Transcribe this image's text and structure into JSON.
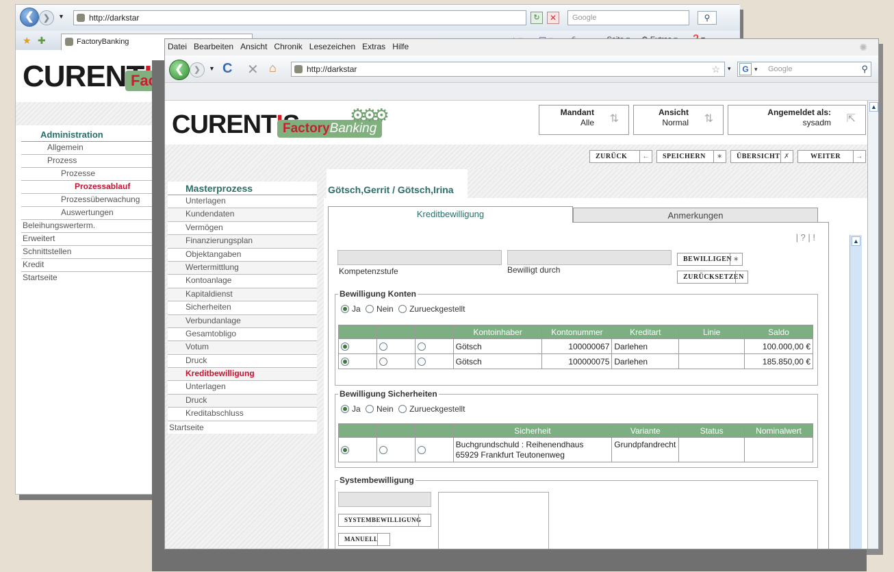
{
  "back_window": {
    "url": "http://darkstar",
    "search_placeholder": "Google",
    "tab_title": "FactoryBanking",
    "toolbar": {
      "seite": "Seite",
      "extras": "Extras"
    },
    "logo": {
      "main": "CURENT",
      "i": "I",
      "s": "S",
      "badge": "Facto"
    },
    "menu": {
      "title": "Administration",
      "items": [
        {
          "label": "Allgemein",
          "level": 1,
          "active": false
        },
        {
          "label": "Prozess",
          "level": 1,
          "active": false
        },
        {
          "label": "Prozesse",
          "level": 2,
          "active": false
        },
        {
          "label": "Prozessablauf",
          "level": 3,
          "active": true
        },
        {
          "label": "Prozessüberwachung",
          "level": 2,
          "active": false
        },
        {
          "label": "Auswertungen",
          "level": 2,
          "active": false
        },
        {
          "label": "Beleihungswerterm.",
          "level": 0,
          "active": false
        },
        {
          "label": "Erweitert",
          "level": 0,
          "active": false
        },
        {
          "label": "Schnittstellen",
          "level": 0,
          "active": false
        },
        {
          "label": "Kredit",
          "level": 0,
          "active": false
        }
      ],
      "footer": "Startseite"
    }
  },
  "front_window": {
    "menubar": [
      "Datei",
      "Bearbeiten",
      "Ansicht",
      "Chronik",
      "Lesezeichen",
      "Extras",
      "Hilfe"
    ],
    "url": "http://darkstar",
    "search_placeholder": "Google",
    "logo": {
      "main": "CURENT",
      "i": "I",
      "s": "S",
      "badge_a": "Factory",
      "badge_b": "Banking"
    },
    "header": {
      "mandant_label": "Mandant",
      "mandant_value": "Alle",
      "ansicht_label": "Ansicht",
      "ansicht_value": "Normal",
      "user_label": "Angemeldet als:",
      "user_value": "sysadm"
    },
    "toolbar": {
      "back": "ZURÜCK",
      "back_sym": "←",
      "save": "SPEICHERN",
      "save_sym": "∗",
      "overview": "ÜBERSICHT",
      "overview_sym": "✗",
      "next": "WEITER",
      "next_sym": "→"
    },
    "sidebar": {
      "title": "Masterprozess",
      "items": [
        {
          "label": "Unterlagen",
          "active": false
        },
        {
          "label": "Kundendaten",
          "active": false
        },
        {
          "label": "Vermögen",
          "active": false
        },
        {
          "label": "Finanzierungsplan",
          "active": false
        },
        {
          "label": "Objektangaben",
          "active": false
        },
        {
          "label": "Wertermittlung",
          "active": false
        },
        {
          "label": "Kontoanlage",
          "active": false
        },
        {
          "label": "Kapitaldienst",
          "active": false
        },
        {
          "label": "Sicherheiten",
          "active": false
        },
        {
          "label": "Verbundanlage",
          "active": false
        },
        {
          "label": "Gesamtobligo",
          "active": false
        },
        {
          "label": "Votum",
          "active": false
        },
        {
          "label": "Druck",
          "active": false
        },
        {
          "label": "Kreditbewilligung",
          "active": true
        },
        {
          "label": "Unterlagen",
          "active": false
        },
        {
          "label": "Druck",
          "active": false
        },
        {
          "label": "Kreditabschluss",
          "active": false
        }
      ],
      "footer": "Startseite"
    },
    "customer": "Götsch,Gerrit / Götsch,Irina",
    "tabs": {
      "active": "Kreditbewilligung",
      "other": "Anmerkungen"
    },
    "help_links": "| ? | !",
    "approval": {
      "kompetenz_label": "Kompetenzstufe",
      "bewilligt_label": "Bewilligt durch",
      "approve_btn": "BEWILLIGEN",
      "approve_sym": "∗",
      "reset_btn": "ZURÜCKSETZEN"
    },
    "konten": {
      "legend": "Bewilligung Konten",
      "options": [
        "Ja",
        "Nein",
        "Zurueckgestellt"
      ],
      "columns": [
        "Kontoinhaber",
        "Kontonummer",
        "Kreditart",
        "Linie",
        "Saldo"
      ],
      "rows": [
        {
          "owner": "Götsch",
          "number": "100000067",
          "type": "Darlehen",
          "line": "",
          "saldo": "100.000,00 €"
        },
        {
          "owner": "Götsch",
          "number": "100000075",
          "type": "Darlehen",
          "line": "",
          "saldo": "185.850,00 €"
        }
      ]
    },
    "sicherheiten": {
      "legend": "Bewilligung Sicherheiten",
      "options": [
        "Ja",
        "Nein",
        "Zurueckgestellt"
      ],
      "columns": [
        "Sicherheit",
        "Variante",
        "Status",
        "Nominalwert"
      ],
      "rows": [
        {
          "line1": "Buchgrundschuld : Reihenendhaus",
          "line2": "65929 Frankfurt Teutonenweg",
          "variant": "Grundpfandrecht",
          "status": "",
          "nominal": ""
        }
      ]
    },
    "system": {
      "legend": "Systembewilligung",
      "btn1": "SYSTEMBEWILLIGUNG",
      "btn2": "MANUELL"
    }
  }
}
